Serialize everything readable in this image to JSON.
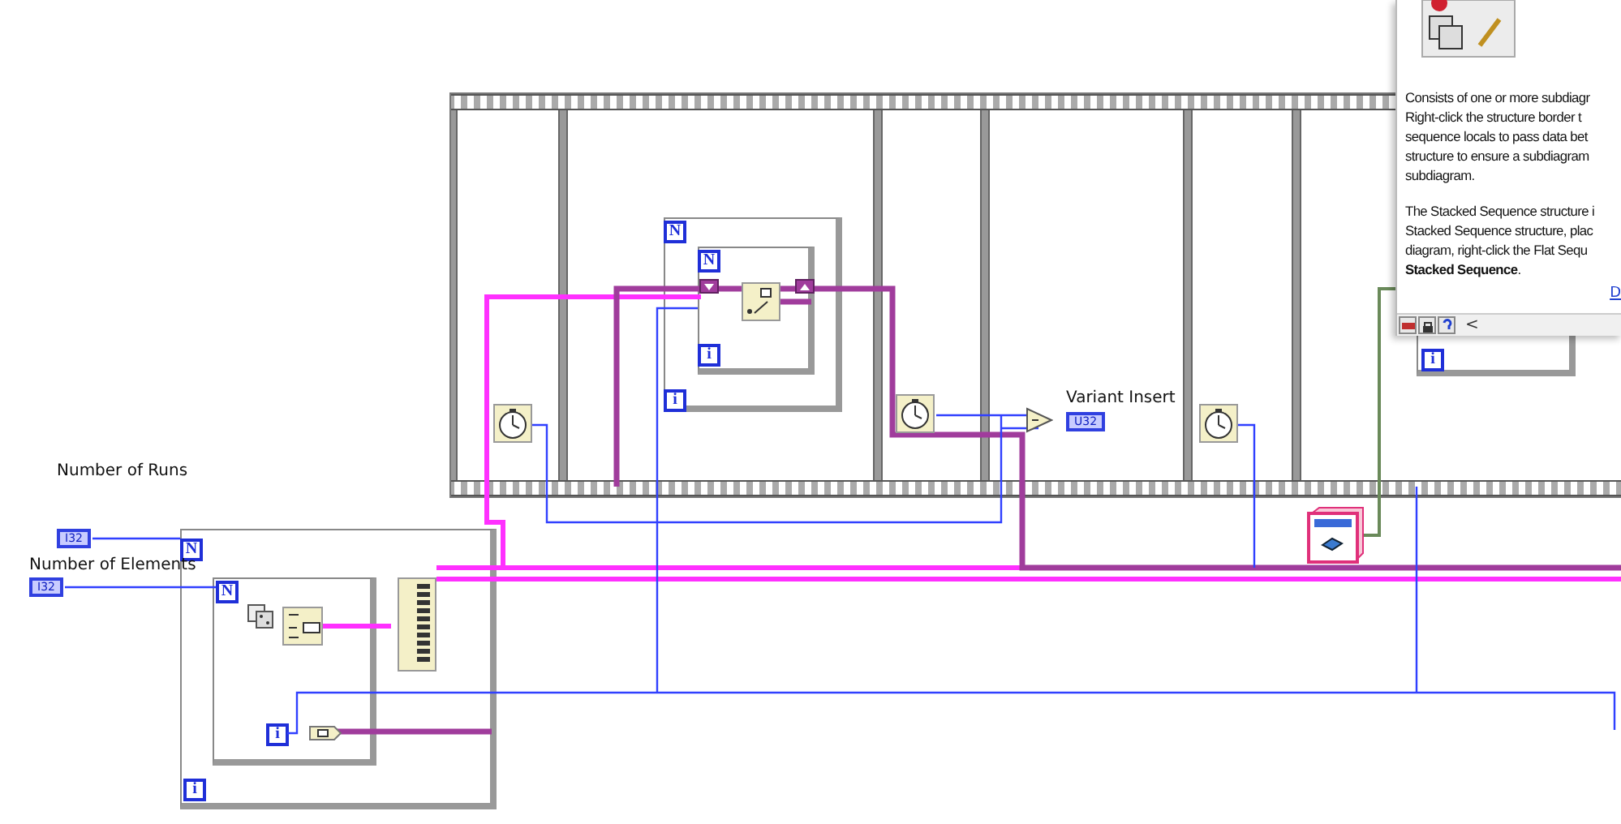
{
  "controls": [
    {
      "label": "Number of Runs",
      "type": "I32"
    },
    {
      "label": "Number of Elements",
      "type": "I32"
    }
  ],
  "loops": [
    {
      "count_label": "N",
      "iteration_label": "i"
    },
    {
      "count_label": "N",
      "iteration_label": "i"
    },
    {
      "count_label": "N",
      "iteration_label": "i"
    },
    {
      "count_label": "N",
      "iteration_label": "i"
    },
    {
      "iteration_label": "i"
    }
  ],
  "indicator": {
    "label": "Variant Insert",
    "type": "U32"
  },
  "help": {
    "paragraphs": [
      [
        "Consists of one or more subdiagr",
        "Right-click the structure border t",
        "sequence locals to pass data bet",
        "structure to ensure a subdiagram",
        "subdiagram."
      ],
      [
        "The Stacked Sequence structure i",
        "Stacked Sequence structure, plac",
        "diagram, right-click the Flat Sequ",
        "**Stacked Sequence**."
      ]
    ],
    "link": "D",
    "back_button": "<"
  }
}
